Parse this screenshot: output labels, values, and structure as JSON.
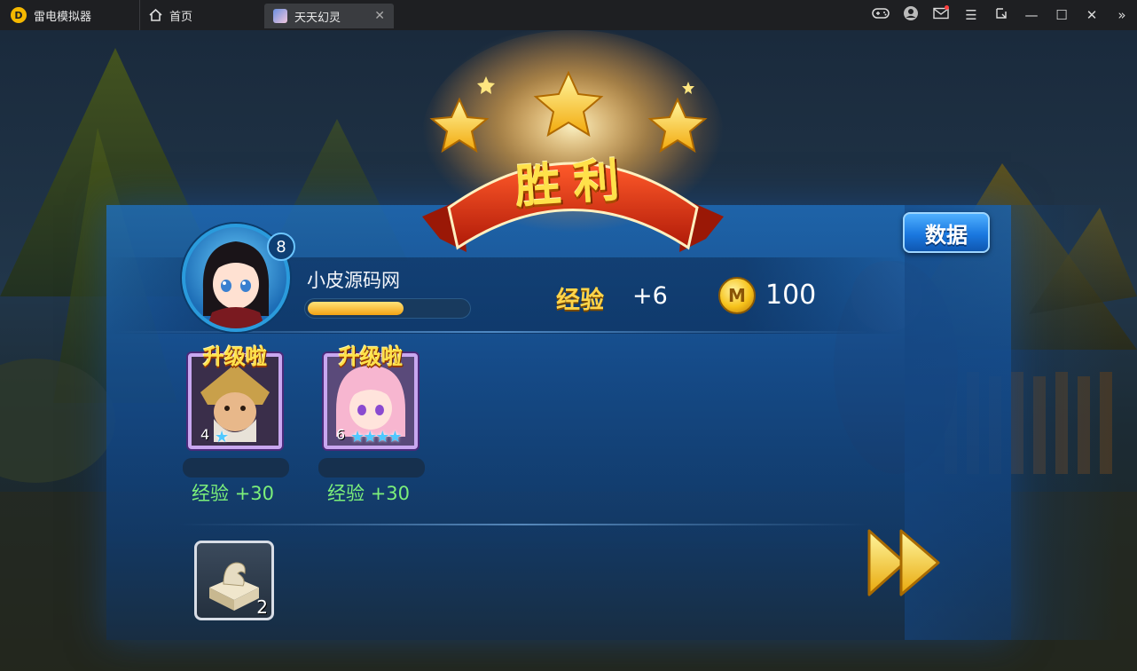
{
  "titlebar": {
    "app_name": "雷电模拟器",
    "home_tab": "首页",
    "game_tab": "天天幻灵",
    "controls": [
      "gamepad-icon",
      "user-icon",
      "mail-icon",
      "menu-icon",
      "expand-icon",
      "minimize-icon",
      "maximize-icon",
      "close-icon",
      "collapse-sidebar-icon"
    ]
  },
  "result": {
    "title": "胜利",
    "data_button": "数据",
    "stars": 3
  },
  "player": {
    "level": "8",
    "name": "小皮源码网",
    "xp_fraction": 0.6,
    "exp_label": "经验",
    "exp_gain": "+6",
    "coins": "100"
  },
  "heroes": [
    {
      "badge": "升级啦",
      "level": "4",
      "stars": 1,
      "exp_label": "经验",
      "exp_gain": "+30"
    },
    {
      "badge": "升级啦",
      "level": "6",
      "stars": 4,
      "exp_label": "经验",
      "exp_gain": "+30"
    }
  ],
  "rewards": [
    {
      "icon": "stone-seal-icon",
      "count": "2"
    }
  ],
  "colors": {
    "accent_blue": "#1a78e0",
    "gold": "#ffd54a",
    "exp_green": "#7cf07a",
    "banner_red": "#d42a10"
  }
}
